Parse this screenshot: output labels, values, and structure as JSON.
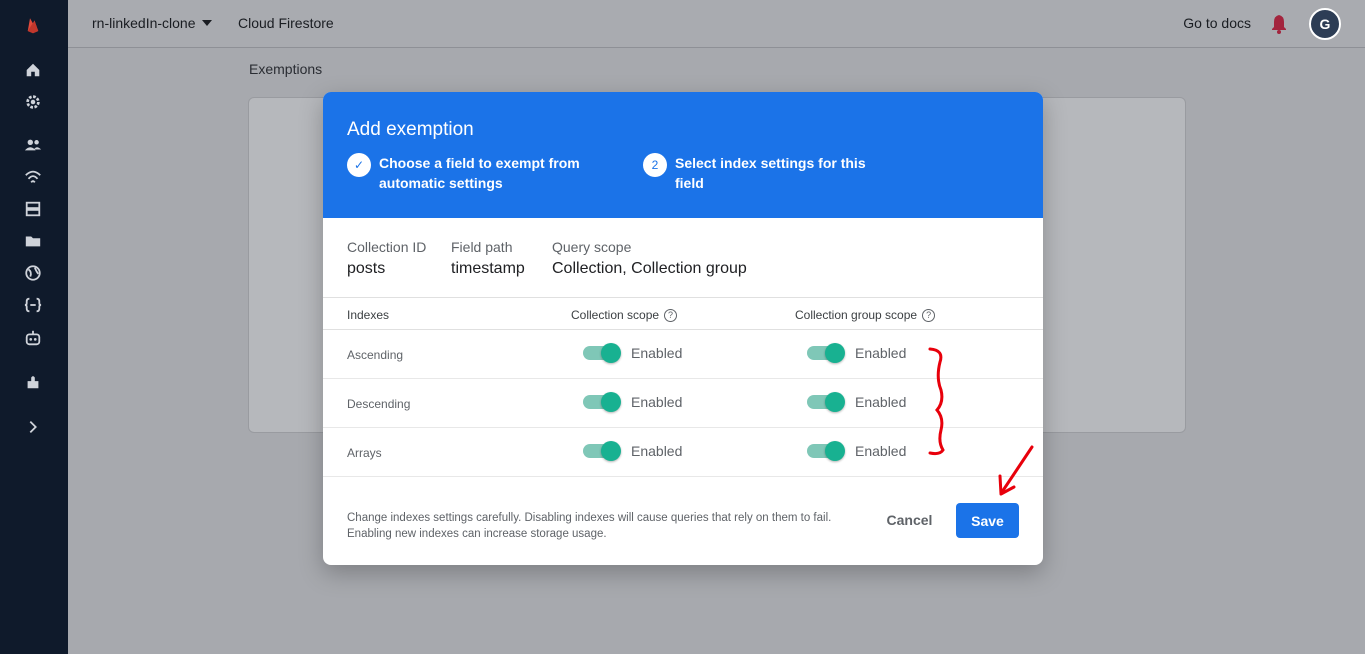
{
  "topbar": {
    "project_name": "rn-linkedIn-clone",
    "product_name": "Cloud Firestore",
    "docs_link": "Go to docs",
    "avatar_initial": "G"
  },
  "breadcrumb": "Exemptions",
  "sidebar": {
    "icons": [
      "firebase-logo-icon",
      "home-icon",
      "settings-icon",
      "users-icon",
      "realtime-database-icon",
      "storage-icon",
      "images-icon",
      "hosting-globe-icon",
      "functions-icon",
      "ml-robot-icon",
      "extensions-icon",
      "expand-chevron-icon"
    ]
  },
  "dialog": {
    "title": "Add exemption",
    "steps": [
      {
        "marker": "✓",
        "label": "Choose a field to exempt from automatic settings"
      },
      {
        "marker": "2",
        "label": "Select index settings for this field"
      }
    ],
    "fields": [
      {
        "label": "Collection ID",
        "value": "posts"
      },
      {
        "label": "Field path",
        "value": "timestamp"
      },
      {
        "label": "Query scope",
        "value": "Collection, Collection group"
      }
    ],
    "table": {
      "headers": [
        "Indexes",
        "Collection scope",
        "Collection group scope"
      ],
      "help_glyph": "?",
      "rows": [
        {
          "name": "Ascending",
          "collection": "Enabled",
          "group": "Enabled"
        },
        {
          "name": "Descending",
          "collection": "Enabled",
          "group": "Enabled"
        },
        {
          "name": "Arrays",
          "collection": "Enabled",
          "group": "Enabled"
        }
      ]
    },
    "footer_note": "Change indexes settings carefully. Disabling indexes will cause queries that rely on them to fail. Enabling new indexes can increase storage usage.",
    "cancel_label": "Cancel",
    "save_label": "Save"
  },
  "colors": {
    "primary": "#1b73e8",
    "toggle_on": "#18b191",
    "sidebar": "#0f1a2b",
    "annotation": "#e8000b"
  }
}
